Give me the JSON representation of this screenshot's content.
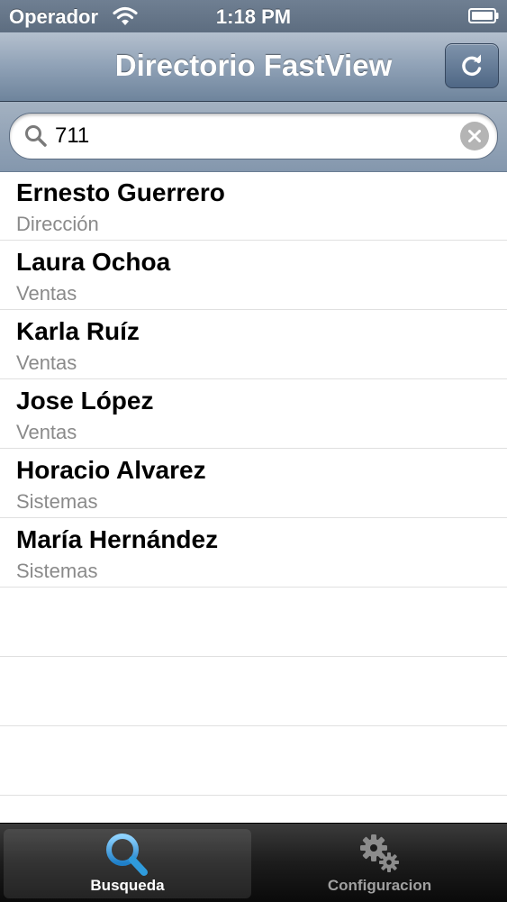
{
  "status_bar": {
    "carrier": "Operador",
    "time": "1:18 PM"
  },
  "nav_bar": {
    "title": "Directorio FastView",
    "refresh_icon": "refresh-icon"
  },
  "search": {
    "value": "711",
    "icon": "search-icon",
    "clear_icon": "clear-icon"
  },
  "contacts": [
    {
      "name": "Ernesto Guerrero",
      "department": "Dirección"
    },
    {
      "name": "Laura Ochoa",
      "department": "Ventas"
    },
    {
      "name": "Karla Ruíz",
      "department": "Ventas"
    },
    {
      "name": "Jose López",
      "department": "Ventas"
    },
    {
      "name": "Horacio Alvarez",
      "department": "Sistemas"
    },
    {
      "name": "María Hernández",
      "department": "Sistemas"
    }
  ],
  "tab_bar": {
    "tabs": [
      {
        "label": "Busqueda",
        "icon": "magnifier-icon",
        "active": true
      },
      {
        "label": "Configuracion",
        "icon": "gears-icon",
        "active": false
      }
    ]
  },
  "colors": {
    "accent_blue": "#2f9bdc",
    "nav_bar": "#8fa1b6",
    "secondary_text": "#8a8a8a"
  }
}
